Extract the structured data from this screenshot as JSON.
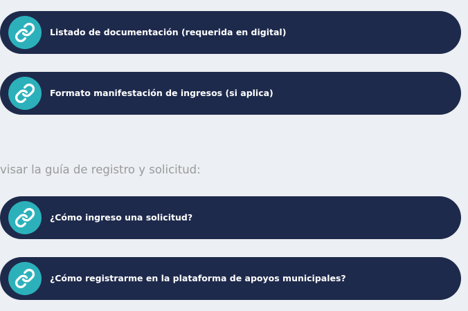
{
  "links_top": [
    {
      "label": "Listado de documentación (requerida en digital)",
      "icon": "link-icon"
    },
    {
      "label": "Formato manifestación de ingresos (si aplica)",
      "icon": "link-icon"
    }
  ],
  "guide_intro": "visar la guía de registro y solicitud:",
  "links_bottom": [
    {
      "label": "¿Cómo ingreso una solicitud?",
      "icon": "link-icon"
    },
    {
      "label": "¿Cómo registrarme en la plataforma de apoyos municipales?",
      "icon": "link-icon"
    }
  ],
  "colors": {
    "page_background": "#eceff3",
    "pill_background": "#1e2a4c",
    "icon_circle": "#2cb1bb",
    "label_text": "#ffffff",
    "intro_text": "#9a9a9a"
  }
}
